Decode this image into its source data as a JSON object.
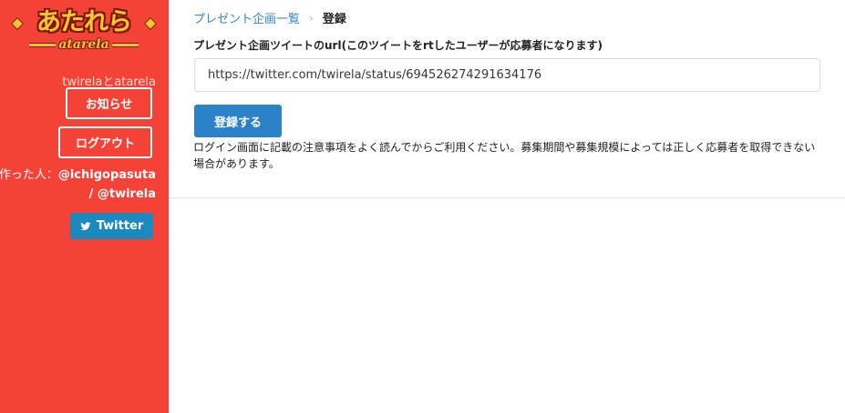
{
  "sidebar": {
    "logo": {
      "main_text": "あたれら",
      "sub_text": "atarela"
    },
    "tagline": "twirelaとatarela",
    "news_label": "お知らせ",
    "logout_label": "ログアウト",
    "author_prefix": "作った人：",
    "author_handle_1": "@ichigopasuta",
    "author_handle_2": "/ @twirela",
    "twitter_label": "Twitter",
    "colors": {
      "background": "#f44336",
      "logo_fill": "#ffc52e",
      "twitter_button": "#1b89bd"
    }
  },
  "breadcrumb": {
    "parent": "プレゼント企画一覧",
    "separator": "›",
    "current": "登録"
  },
  "form": {
    "field_label": "プレゼント企画ツイートのurl(このツイートをrtしたユーザーが応募者になります)",
    "url_value": "https://twitter.com/twirela/status/694526274291634176",
    "submit_label": "登録する",
    "notice": "ログイン画面に記載の注意事項をよく読んでからご利用ください。募集期間や募集規模によっては正しく応募者を取得できない場合があります。"
  },
  "icons": {
    "twitter": "twitter-bird-icon",
    "breadcrumb_separator": "chevron-right-icon"
  }
}
